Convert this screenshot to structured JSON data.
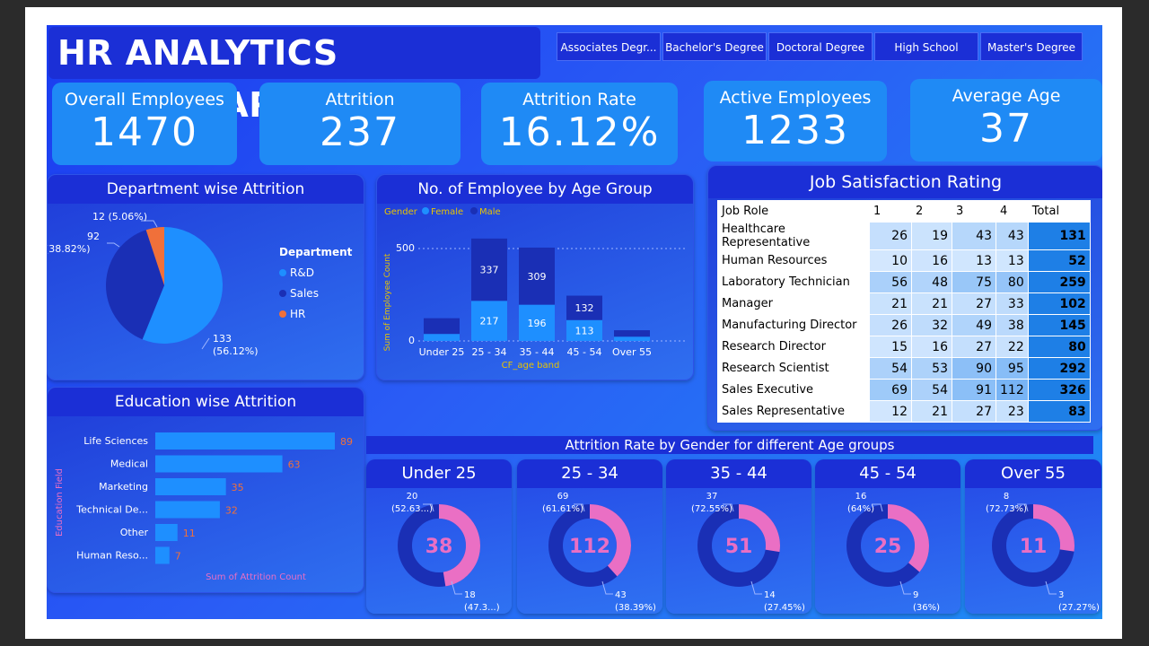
{
  "header": {
    "title": "HR ANALYTICS DASHBOARD"
  },
  "slicers": [
    "Associates Degr...",
    "Bachelor's Degree",
    "Doctoral Degree",
    "High School",
    "Master's Degree"
  ],
  "kpis": [
    {
      "label": "Overall Employees",
      "value": "1470"
    },
    {
      "label": "Attrition",
      "value": "237"
    },
    {
      "label": "Attrition Rate",
      "value": "16.12%"
    },
    {
      "label": "Active Employees",
      "value": "1233"
    },
    {
      "label": "Average Age",
      "value": "37"
    }
  ],
  "dept": {
    "title": "Department wise Attrition",
    "legend_title": "Department",
    "labels": {
      "hr": "12 (5.06%)",
      "sales_a": "92",
      "sales_b": "(38.82%)",
      "rd_a": "133",
      "rd_b": "(56.12%)"
    },
    "legend": [
      "R&D",
      "Sales",
      "HR"
    ]
  },
  "age": {
    "title": "No. of Employee by Age Group",
    "legend_title": "Gender",
    "legend": [
      "Female",
      "Male"
    ],
    "ylabel": "Sum of Employee Count",
    "xlabel": "CF_age band",
    "yticks": [
      "500",
      "0"
    ],
    "seglabels": [
      "337",
      "217",
      "309",
      "196",
      "132",
      "113"
    ]
  },
  "edu": {
    "title": "Education wise Attrition",
    "ylabel": "Education Field",
    "xlabel": "Sum of Attrition Count"
  },
  "jobsat": {
    "title": "Job Satisfaction Rating",
    "columns": [
      "Job Role",
      "1",
      "2",
      "3",
      "4",
      "Total"
    ],
    "rows": [
      [
        "Healthcare Representative",
        "26",
        "19",
        "43",
        "43",
        "131"
      ],
      [
        "Human Resources",
        "10",
        "16",
        "13",
        "13",
        "52"
      ],
      [
        "Laboratory Technician",
        "56",
        "48",
        "75",
        "80",
        "259"
      ],
      [
        "Manager",
        "21",
        "21",
        "27",
        "33",
        "102"
      ],
      [
        "Manufacturing Director",
        "26",
        "32",
        "49",
        "38",
        "145"
      ],
      [
        "Research Director",
        "15",
        "16",
        "27",
        "22",
        "80"
      ],
      [
        "Research Scientist",
        "54",
        "53",
        "90",
        "95",
        "292"
      ],
      [
        "Sales Executive",
        "69",
        "54",
        "91",
        "112",
        "326"
      ],
      [
        "Sales Representative",
        "12",
        "21",
        "27",
        "23",
        "83"
      ]
    ]
  },
  "gender_title": "Attrition Rate by Gender for different Age groups",
  "donuts": [
    {
      "title": "Under 25",
      "total": "38",
      "top_a": "20",
      "top_b": "(52.63...)",
      "bot_a": "18",
      "bot_b": "(47.3...)",
      "pink_fraction": 0.4737
    },
    {
      "title": "25 - 34",
      "total": "112",
      "top_a": "69",
      "top_b": "(61.61%)",
      "bot_a": "43",
      "bot_b": "(38.39%)",
      "pink_fraction": 0.3839
    },
    {
      "title": "35 - 44",
      "total": "51",
      "top_a": "37",
      "top_b": "(72.55%)",
      "bot_a": "14",
      "bot_b": "(27.45%)",
      "pink_fraction": 0.2745
    },
    {
      "title": "45 - 54",
      "total": "25",
      "top_a": "16",
      "top_b": "(64%)",
      "bot_a": "9",
      "bot_b": "(36%)",
      "pink_fraction": 0.36
    },
    {
      "title": "Over 55",
      "total": "11",
      "top_a": "8",
      "top_b": "(72.73%)",
      "bot_a": "3",
      "bot_b": "(27.27%)",
      "pink_fraction": 0.2727
    }
  ],
  "colors": {
    "rd": "#1e8fff",
    "sales": "#1a2fb5",
    "hr": "#f0703a",
    "female": "#1e8fff",
    "male": "#1a2fb5",
    "pink": "#ea6fc4",
    "bar": "#1e8fff",
    "barlabel": "#f0703a"
  },
  "chart_data": [
    {
      "type": "pie",
      "title": "Department wise Attrition",
      "categories": [
        "R&D",
        "Sales",
        "HR"
      ],
      "values": [
        133,
        92,
        12
      ],
      "percent": [
        56.12,
        38.82,
        5.06
      ]
    },
    {
      "type": "bar",
      "title": "No. of Employee by Age Group",
      "xlabel": "CF_age band",
      "ylabel": "Sum of Employee Count",
      "categories": [
        "Under 25",
        "25 - 34",
        "35 - 44",
        "45 - 54",
        "Over 55"
      ],
      "series": [
        {
          "name": "Female",
          "values": [
            38,
            217,
            196,
            113,
            23
          ]
        },
        {
          "name": "Male",
          "values": [
            85,
            337,
            309,
            132,
            35
          ]
        }
      ],
      "ylim": [
        0,
        600
      ]
    },
    {
      "type": "bar",
      "title": "Education wise Attrition",
      "xlabel": "Sum of Attrition Count",
      "ylabel": "Education Field",
      "categories": [
        "Life Sciences",
        "Medical",
        "Marketing",
        "Technical De...",
        "Other",
        "Human Reso..."
      ],
      "values": [
        89,
        63,
        35,
        32,
        11,
        7
      ]
    }
  ]
}
